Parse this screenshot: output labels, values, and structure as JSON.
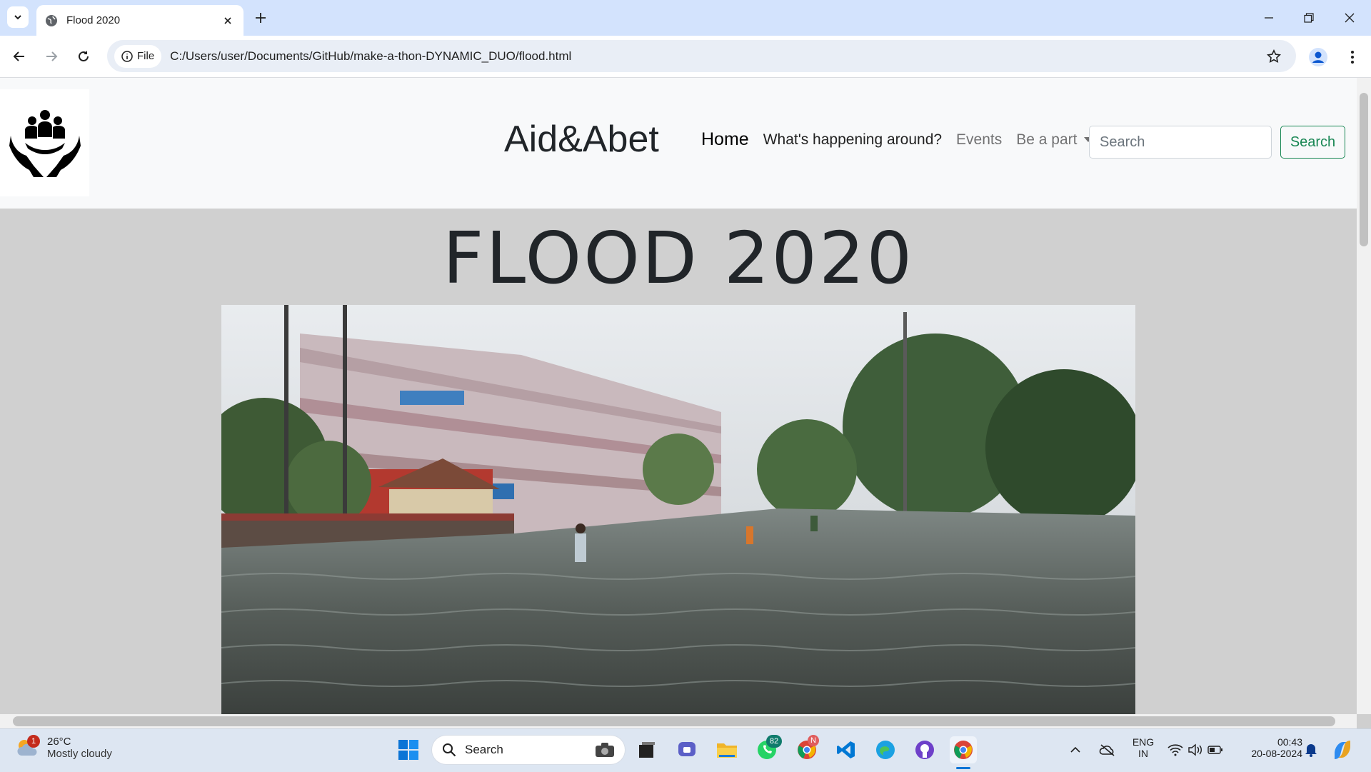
{
  "browser": {
    "tab_title": "Flood 2020",
    "omnibox_chip": "File",
    "url": "C:/Users/user/Documents/GitHub/make-a-thon-DYNAMIC_DUO/flood.html"
  },
  "site": {
    "brand": "Aid&Abet",
    "nav": {
      "home": "Home",
      "whats_happening": "What's happening around?",
      "events": "Events",
      "be_a_part": "Be a part"
    },
    "search": {
      "placeholder": "Search",
      "button_label": "Search"
    },
    "page_title": "FLOOD 2020",
    "hero_image": "flooded-street-photo"
  },
  "taskbar": {
    "weather": {
      "temperature": "26°C",
      "condition": "Mostly cloudy",
      "badge": "1"
    },
    "search_label": "Search",
    "whatsapp_badge": "82",
    "chrome_profile_badge": "N",
    "language_line1": "ENG",
    "language_line2": "IN",
    "time": "00:43",
    "date": "20-08-2024"
  },
  "colors": {
    "tabbar": "#d3e3fd",
    "nav_bg": "#f8f9fa",
    "page_bg": "#d0d0d0",
    "search_green": "#198754"
  }
}
